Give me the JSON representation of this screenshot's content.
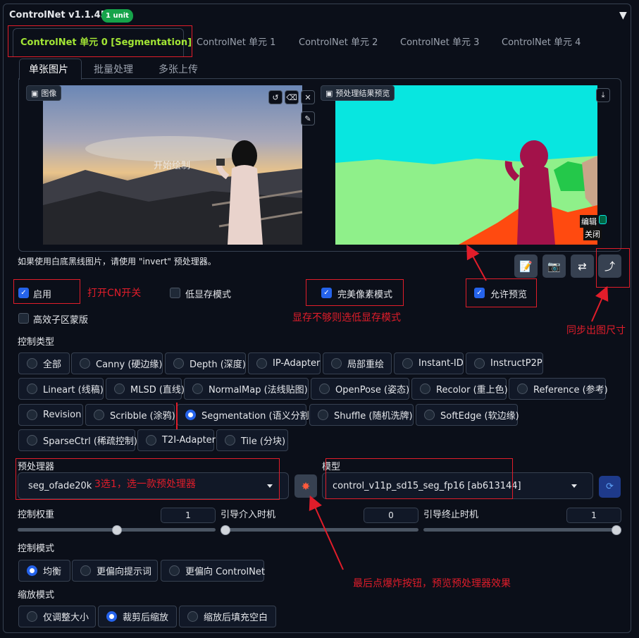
{
  "header": {
    "title": "ControlNet v1.1.455",
    "badge": "1 unit"
  },
  "tabs": [
    "ControlNet 单元 0 [Segmentation]",
    "ControlNet 单元 1",
    "ControlNet 单元 2",
    "ControlNet 单元 3",
    "ControlNet 单元 4"
  ],
  "subtabs": [
    "单张图片",
    "批量处理",
    "多张上传"
  ],
  "image_panel": {
    "label": "图像",
    "watermark": "开始绘制"
  },
  "preview_panel": {
    "label": "预处理结果预览",
    "edit": "编辑",
    "close": "关闭"
  },
  "hint": "如果使用白底黑线图片，请使用 \"invert\" 预处理器。",
  "checkboxes": {
    "enable": "启用",
    "low_vram": "低显存模式",
    "pixel_perfect": "完美像素模式",
    "allow_preview": "允许预览",
    "efficient_mask": "高效子区蒙版"
  },
  "control_type": {
    "label": "控制类型",
    "options": [
      "全部",
      "Canny (硬边缘)",
      "Depth (深度)",
      "IP-Adapter",
      "局部重绘",
      "Instant-ID",
      "InstructP2P",
      "Lineart (线稿)",
      "MLSD (直线)",
      "NormalMap (法线贴图)",
      "OpenPose (姿态)",
      "Recolor (重上色)",
      "Reference (参考)",
      "Revision",
      "Scribble (涂鸦)",
      "Segmentation (语义分割)",
      "Shuffle (随机洗牌)",
      "SoftEdge (软边缘)",
      "SparseCtrl (稀疏控制)",
      "T2I-Adapter",
      "Tile (分块)"
    ],
    "selected": "Segmentation (语义分割)"
  },
  "preprocessor": {
    "label": "预处理器",
    "value": "seg_ofade20k"
  },
  "model": {
    "label": "模型",
    "value": "control_v11p_sd15_seg_fp16 [ab613144]"
  },
  "sliders": {
    "weight": {
      "label": "控制权重",
      "value": "1",
      "fraction": 0.5
    },
    "start": {
      "label": "引导介入时机",
      "value": "0",
      "fraction": 0.0
    },
    "end": {
      "label": "引导终止时机",
      "value": "1",
      "fraction": 1.0
    }
  },
  "control_mode": {
    "label": "控制模式",
    "options": [
      "均衡",
      "更偏向提示词",
      "更偏向 ControlNet"
    ],
    "selected": "均衡"
  },
  "resize_mode": {
    "label": "缩放模式",
    "options": [
      "仅调整大小",
      "裁剪后缩放",
      "缩放后填充空白"
    ],
    "selected": "裁剪后缩放"
  },
  "annotations": {
    "enable": "打开CN开关",
    "low_vram": "显存不够则选低显存模式",
    "sync": "同步出图尺寸",
    "preprocessor": "3选1，选一款预处理器",
    "explode": "最后点爆炸按钮，预览预处理器效果"
  },
  "colors": {
    "accent": "#2563eb",
    "annotation": "#e11d2a",
    "active_tab": "#a3e635",
    "badge": "#16a34a"
  }
}
